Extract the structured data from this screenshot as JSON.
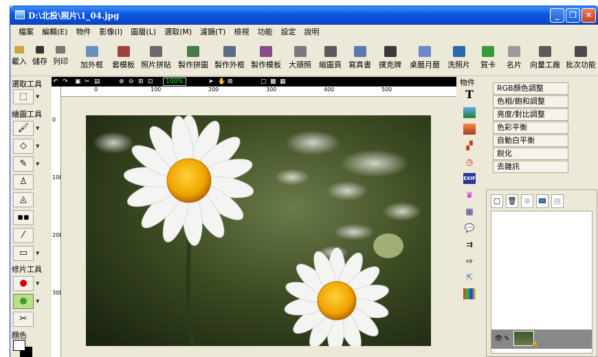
{
  "window": {
    "title": "D:\\北投\\照片\\1_04.jpg",
    "minimize_label": "_",
    "restore_label": "❐",
    "close_label": "✕"
  },
  "menu": [
    "檔案",
    "編輯(E)",
    "物件",
    "影像(I)",
    "圖層(L)",
    "選取(M)",
    "濾鏡(T)",
    "檢視",
    "功能",
    "設定",
    "說明"
  ],
  "toolbar": {
    "items": [
      {
        "label": "載入",
        "icon": "open-folder-icon",
        "color": "#c9a24a"
      },
      {
        "label": "儲存",
        "icon": "save-disk-icon",
        "color": "#333333"
      },
      {
        "label": "列印",
        "icon": "printer-icon",
        "color": "#555555"
      },
      {
        "label": "加外框",
        "icon": "frame-icon",
        "color": "#6a8fbf"
      },
      {
        "label": "套模板",
        "icon": "template-icon",
        "color": "#a04040"
      },
      {
        "label": "照片拼貼",
        "icon": "collage-icon",
        "color": "#6a6a6a"
      },
      {
        "label": "製作拼圖",
        "icon": "puzzle-icon",
        "color": "#4a7a4a"
      },
      {
        "label": "製作外框",
        "icon": "make-frame-icon",
        "color": "#5a6a8a"
      },
      {
        "label": "製作模板",
        "icon": "make-template-icon",
        "color": "#8a4a8a"
      },
      {
        "label": "大頭照",
        "icon": "id-photo-icon",
        "color": "#7a7a7a"
      },
      {
        "label": "縮圖頁",
        "icon": "thumbnail-page-icon",
        "color": "#5a5a5a"
      },
      {
        "label": "寫真書",
        "icon": "photobook-icon",
        "color": "#5a7aaa"
      },
      {
        "label": "撲克牌",
        "icon": "poker-card-icon",
        "color": "#3a3a3a"
      },
      {
        "label": "桌曆月曆",
        "icon": "calendar-icon",
        "color": "#6a8acc"
      },
      {
        "label": "洗照片",
        "icon": "print-photo-icon",
        "color": "#2a6aaa"
      },
      {
        "label": "賀卡",
        "icon": "greeting-card-icon",
        "color": "#3a9a3a"
      },
      {
        "label": "名片",
        "icon": "business-card-icon",
        "color": "#9a9a9a"
      },
      {
        "label": "向量工廠",
        "icon": "vector-icon",
        "color": "#5a5a5a"
      },
      {
        "label": "批次功能",
        "icon": "batch-icon",
        "color": "#4a4a4a"
      }
    ]
  },
  "left_panel": {
    "select_title": "選取工具",
    "draw_title": "繪圖工具",
    "retouch_title": "修片工具",
    "color_title": "顏色",
    "foreground_color": "#ffffff",
    "background_color": "#000000"
  },
  "canvas": {
    "zoom": "100%",
    "ruler_h": [
      "0",
      "100",
      "200",
      "300",
      "400",
      "500"
    ],
    "ruler_v": [
      "0",
      "100",
      "200",
      "300"
    ]
  },
  "object_column": {
    "title": "物件",
    "icons": [
      "text-icon",
      "image-icon",
      "photo-icon",
      "layers-icon",
      "clock-icon",
      "exif-icon",
      "cake-icon",
      "calendar-grid-icon",
      "speech-bubble-icon",
      "double-arrow-icon",
      "arrow-right-icon",
      "cursor-star-icon",
      "color-grid-icon"
    ]
  },
  "adjustments": [
    "RGB顏色調整",
    "色相/飽和調整",
    "亮度/對比調整",
    "色彩平衡",
    "自動白平衡",
    "銳化",
    "去雜訊"
  ],
  "layers": {
    "tools": [
      "new-layer-icon",
      "delete-layer-icon",
      "lock-layer-icon",
      "layer-image-icon",
      "layer-grid-icon"
    ]
  }
}
